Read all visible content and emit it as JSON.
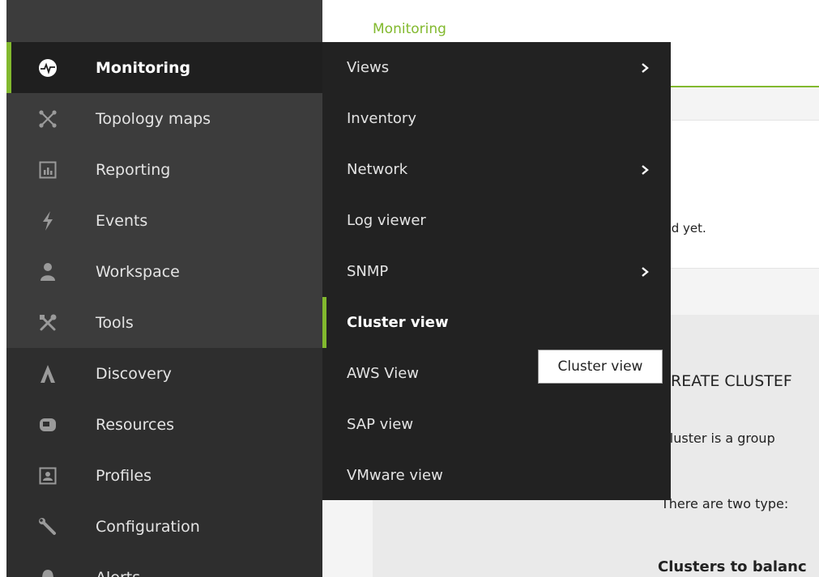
{
  "breadcrumb": "Monitoring",
  "colors": {
    "accent": "#82b92e",
    "sidebar_bg": "#3c3c3c",
    "submenu_bg": "#222222"
  },
  "sidebar": {
    "items": [
      {
        "label": "Monitoring",
        "icon": "pulse-icon",
        "active": true
      },
      {
        "label": "Topology maps",
        "icon": "topology-icon"
      },
      {
        "label": "Reporting",
        "icon": "chart-icon"
      },
      {
        "label": "Events",
        "icon": "lightning-icon"
      },
      {
        "label": "Workspace",
        "icon": "user-icon"
      },
      {
        "label": "Tools",
        "icon": "tools-icon"
      },
      {
        "label": "Discovery",
        "icon": "discovery-icon"
      },
      {
        "label": "Resources",
        "icon": "resources-icon"
      },
      {
        "label": "Profiles",
        "icon": "profile-icon"
      },
      {
        "label": "Configuration",
        "icon": "wrench-icon"
      },
      {
        "label": "Alerts",
        "icon": "bell-icon"
      }
    ]
  },
  "submenu": {
    "items": [
      {
        "label": "Views",
        "has_children": true
      },
      {
        "label": "Inventory"
      },
      {
        "label": "Network",
        "has_children": true
      },
      {
        "label": "Log viewer"
      },
      {
        "label": "SNMP",
        "has_children": true
      },
      {
        "label": "Cluster view",
        "active": true
      },
      {
        "label": "AWS View"
      },
      {
        "label": "SAP view"
      },
      {
        "label": "VMware view"
      }
    ]
  },
  "tooltip": "Cluster view",
  "main": {
    "notice": "ned yet.",
    "create_title": "REATE CLUSTEF",
    "cluster_desc": "cluster is a group",
    "types_desc": "There are two type:",
    "balance_title": "Clusters to balanc"
  }
}
